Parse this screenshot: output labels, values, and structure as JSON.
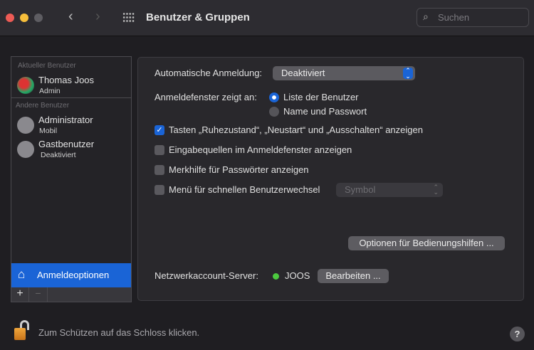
{
  "window": {
    "title": "Benutzer & Gruppen",
    "search_placeholder": "Suchen"
  },
  "sidebar": {
    "current_header": "Aktueller Benutzer",
    "current_user": {
      "name": "Thomas Joos",
      "role": "Admin"
    },
    "others_header": "Andere Benutzer",
    "others": [
      {
        "name": "Administrator",
        "role": "Mobil"
      },
      {
        "name": "Gastbenutzer",
        "role": "Deaktiviert"
      }
    ],
    "login_options": "Anmeldeoptionen",
    "add": "+",
    "remove": "−"
  },
  "main": {
    "auto_login_label": "Automatische Anmeldung:",
    "auto_login_value": "Deaktiviert",
    "login_window_label": "Anmeldefenster zeigt an:",
    "radio_options": [
      {
        "label": "Liste der Benutzer",
        "selected": true
      },
      {
        "label": "Name und Passwort",
        "selected": false
      }
    ],
    "checkboxes": [
      {
        "label": "Tasten „Ruhezustand“, „Neustart“ und „Ausschalten“ anzeigen",
        "checked": true
      },
      {
        "label": "Eingabequellen im Anmeldefenster anzeigen",
        "checked": false
      },
      {
        "label": "Merkhilfe für Passwörter anzeigen",
        "checked": false
      },
      {
        "label": "Menü für schnellen Benutzerwechsel",
        "checked": false
      }
    ],
    "fast_switch_value": "Symbol",
    "accessibility_button": "Optionen für Bedienungshilfen ...",
    "network_label": "Netzwerkaccount-Server:",
    "network_server": "JOOS",
    "network_status_color": "#4cc93f",
    "edit_button": "Bearbeiten ..."
  },
  "footer": {
    "lock_text": "Zum Schützen auf das Schloss klicken.",
    "help": "?"
  },
  "colors": {
    "accent": "#1a64d6"
  }
}
